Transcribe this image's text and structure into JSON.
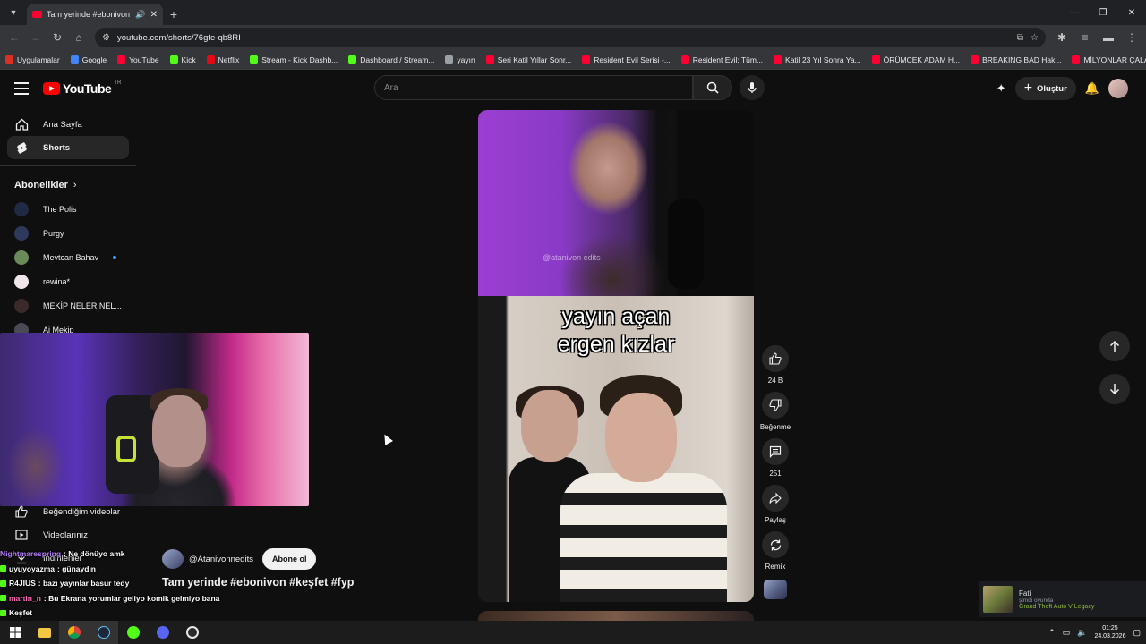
{
  "browser": {
    "tab_title": "Tam yerinde #ebonivon #keşfet #fyp - YouTube",
    "url": "youtube.com/shorts/76gfe-qb8RI",
    "bookmarks": [
      {
        "label": "Uygulamalar",
        "color": "#d93025"
      },
      {
        "label": "Google",
        "color": "#4285f4"
      },
      {
        "label": "YouTube",
        "color": "#ff0033"
      },
      {
        "label": "Kick",
        "color": "#53fc18"
      },
      {
        "label": "Netflix",
        "color": "#e50914"
      },
      {
        "label": "Stream - Kick Dashb...",
        "color": "#53fc18"
      },
      {
        "label": "Dashboard / Stream...",
        "color": "#53fc18"
      },
      {
        "label": "yayın",
        "color": "#9aa0a6"
      },
      {
        "label": "Seri Katil Yıllar Sonr...",
        "color": "#ff0033"
      },
      {
        "label": "Resident Evil Serisi -...",
        "color": "#ff0033"
      },
      {
        "label": "Resident Evil: Tüm...",
        "color": "#ff0033"
      },
      {
        "label": "Katil 23 Yıl Sonra Ya...",
        "color": "#ff0033"
      },
      {
        "label": "ÖRÜMCEK ADAM H...",
        "color": "#ff0033"
      },
      {
        "label": "BREAKING BAD Hak...",
        "color": "#ff0033"
      },
      {
        "label": "MİLYONLAR ÇALAR...",
        "color": "#ff0033"
      }
    ]
  },
  "header": {
    "logo": "YouTube",
    "country": "TR",
    "search_placeholder": "Ara",
    "create_label": "Oluştur"
  },
  "sidebar": {
    "home": "Ana Sayfa",
    "shorts": "Shorts",
    "subscriptions_title": "Abonelikler",
    "subscriptions": [
      {
        "name": "The Polis",
        "color": "#1f2a44",
        "live": false
      },
      {
        "name": "Purgy",
        "color": "#2e3a5c",
        "live": false
      },
      {
        "name": "Mevtcan Bahav",
        "color": "#6b8a5a",
        "live": true
      },
      {
        "name": "rewina*",
        "color": "#f0e6ea",
        "live": false
      },
      {
        "name": "MEKİP NELER NEL...",
        "color": "#3a2a2a",
        "live": false
      },
      {
        "name": "Ai Mekip",
        "color": "#4a4a55",
        "live": false
      }
    ],
    "liked": "Beğendiğim videolar",
    "your_videos": "Videolarınız",
    "downloads": "İndirilenler"
  },
  "video": {
    "caption_line1": "yayın açan",
    "caption_line2": "ergen kızlar",
    "watermark": "@atanivon edits",
    "channel_name": "@Atanivonnedits",
    "subscribe_label": "Abone ol",
    "title": "Tam yerinde #ebonivon #keşfet #fyp"
  },
  "actions": {
    "likes": "24 B",
    "dislike": "Beğenme",
    "comments": "251",
    "share": "Paylaş",
    "remix": "Remix"
  },
  "chat": [
    {
      "user": "Nightmarespring",
      "color": "#b57cff",
      "msg": ": Ne dönüyo amk"
    },
    {
      "user": "uyuyoyazma",
      "color": "#ffffff",
      "msg": ": günaydın"
    },
    {
      "user": "R4JIUS",
      "color": "#ffffff",
      "msg": ": bazı yayınlar basur tedy"
    },
    {
      "user": "martin_n",
      "color": "#ff6bb5",
      "msg": ": Bu Ekrana yorumlar geliyo komik gelmiyo bana"
    },
    {
      "user": "Keşfet",
      "color": "#ffffff",
      "msg": ""
    }
  ],
  "notification": {
    "name": "Fati",
    "status": "şimdi oyunda",
    "game": "Grand Theft Auto V Legacy"
  },
  "taskbar": {
    "time": "01:25",
    "date": "24.03.2026"
  }
}
